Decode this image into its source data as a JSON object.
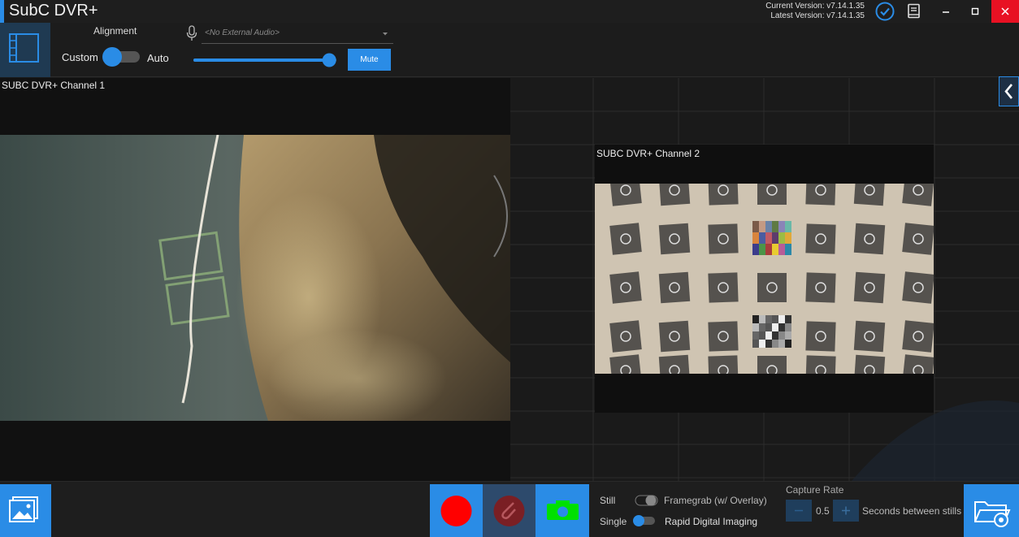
{
  "app": {
    "title": "SubC DVR+"
  },
  "titlebar": {
    "current_version": "Current Version: v7.14.1.35",
    "latest_version": "Latest Version: v7.14.1.35"
  },
  "toolbar": {
    "alignment_label": "Alignment",
    "custom_label": "Custom",
    "auto_label": "Auto",
    "audio_placeholder": "<No External Audio>",
    "mute_label": "Mute",
    "volume_level": 0.95
  },
  "channels": [
    {
      "label": "SUBC DVR+ Channel 1"
    },
    {
      "label": "SUBC DVR+ Channel 2"
    }
  ],
  "bottom": {
    "still_label": "Still",
    "single_label": "Single",
    "framegrab_label": "Framegrab (w/ Overlay)",
    "rdi_label": "Rapid Digital Imaging",
    "capture_rate_label": "Capture Rate",
    "capture_rate_value": "0.5",
    "seconds_label": "Seconds between stills"
  },
  "colors": {
    "accent": "#2a8ce6",
    "record": "#ff0000",
    "close": "#e81123",
    "camera": "#00e000"
  }
}
